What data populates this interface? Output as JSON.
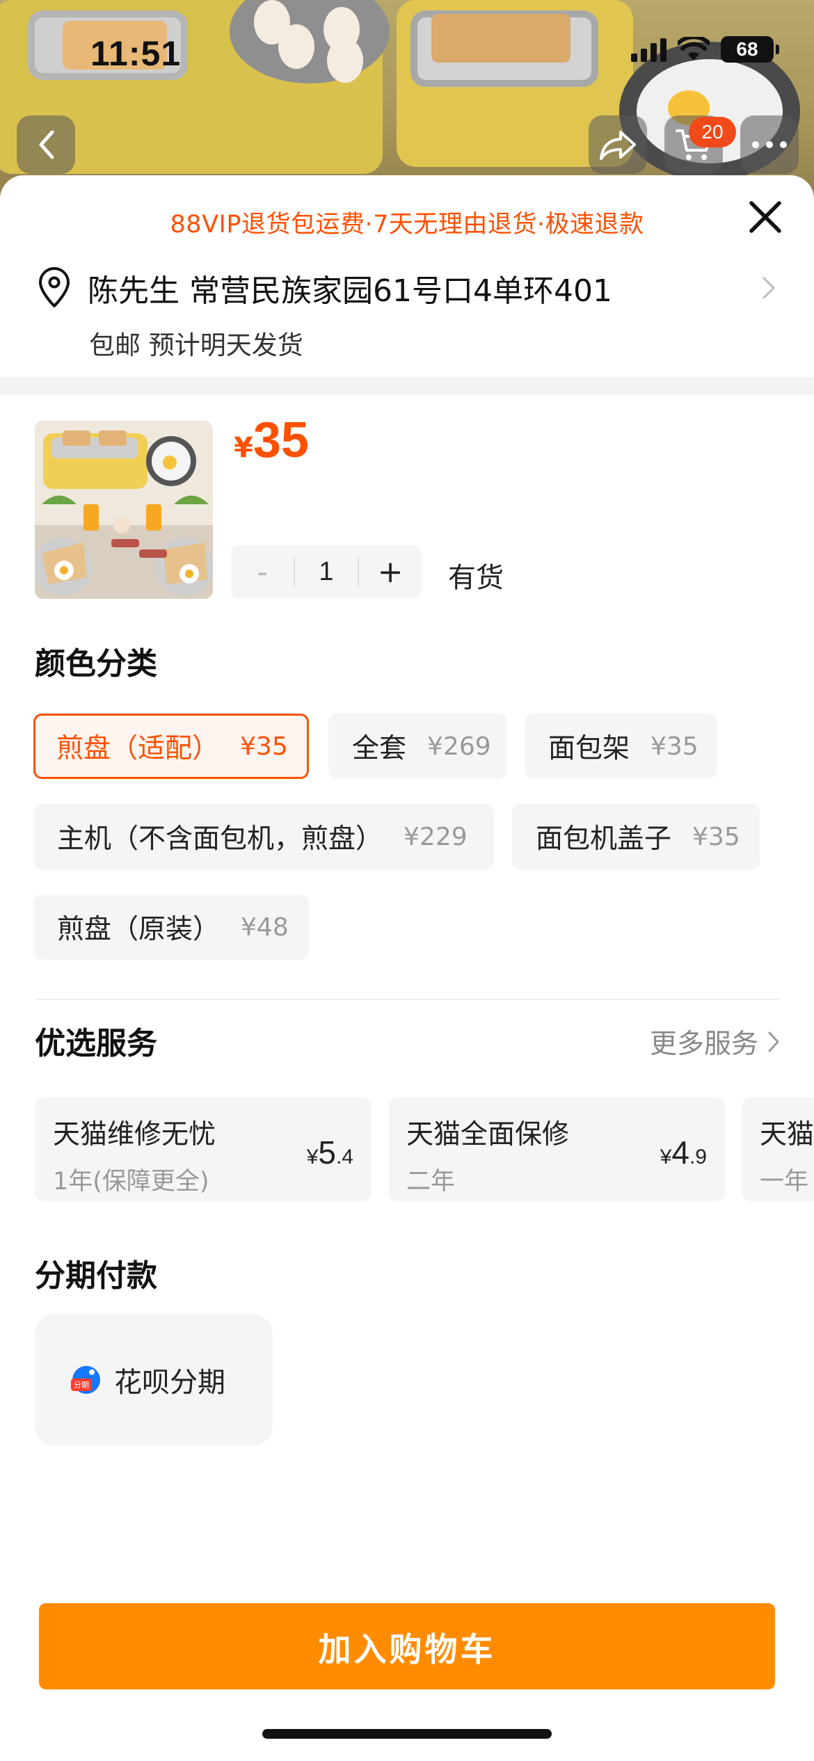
{
  "status_bar": {
    "time": "11:51",
    "battery": "68"
  },
  "top_nav": {
    "cart_badge": "20"
  },
  "sheet": {
    "promo_text": "88VIP退货包运费·7天无理由退货·极速退款",
    "address": "陈先生 常营民族家园61号口4单环401",
    "shipping": "包邮 预计明天发货"
  },
  "product": {
    "currency": "¥",
    "price": "35",
    "quantity": "1",
    "minus": "-",
    "plus": "+",
    "stock": "有货"
  },
  "color_section": {
    "title": "颜色分类",
    "options": [
      {
        "label": "煎盘（适配）",
        "price": "¥35",
        "selected": true
      },
      {
        "label": "全套",
        "price": "¥269",
        "selected": false
      },
      {
        "label": "面包架",
        "price": "¥35",
        "selected": false
      },
      {
        "label": "主机（不含面包机，煎盘）",
        "price": "¥229",
        "selected": false
      },
      {
        "label": "面包机盖子",
        "price": "¥35",
        "selected": false
      },
      {
        "label": "煎盘（原装）",
        "price": "¥48",
        "selected": false
      }
    ]
  },
  "services": {
    "title": "优选服务",
    "more": "更多服务",
    "items": [
      {
        "name": "天猫维修无忧",
        "sub": "1年(保障更全)",
        "cur": "¥",
        "price_int": "5",
        "price_dec": ".4"
      },
      {
        "name": "天猫全面保修",
        "sub": "二年",
        "cur": "¥",
        "price_int": "4",
        "price_dec": ".9"
      },
      {
        "name": "天猫",
        "sub": "一年"
      }
    ]
  },
  "installment": {
    "title": "分期付款",
    "option": "花呗分期",
    "logo_text": "分期"
  },
  "actions": {
    "add_to_cart": "加入购物车"
  },
  "colors": {
    "accent": "#ff5000",
    "cta": "#ff8c00"
  }
}
